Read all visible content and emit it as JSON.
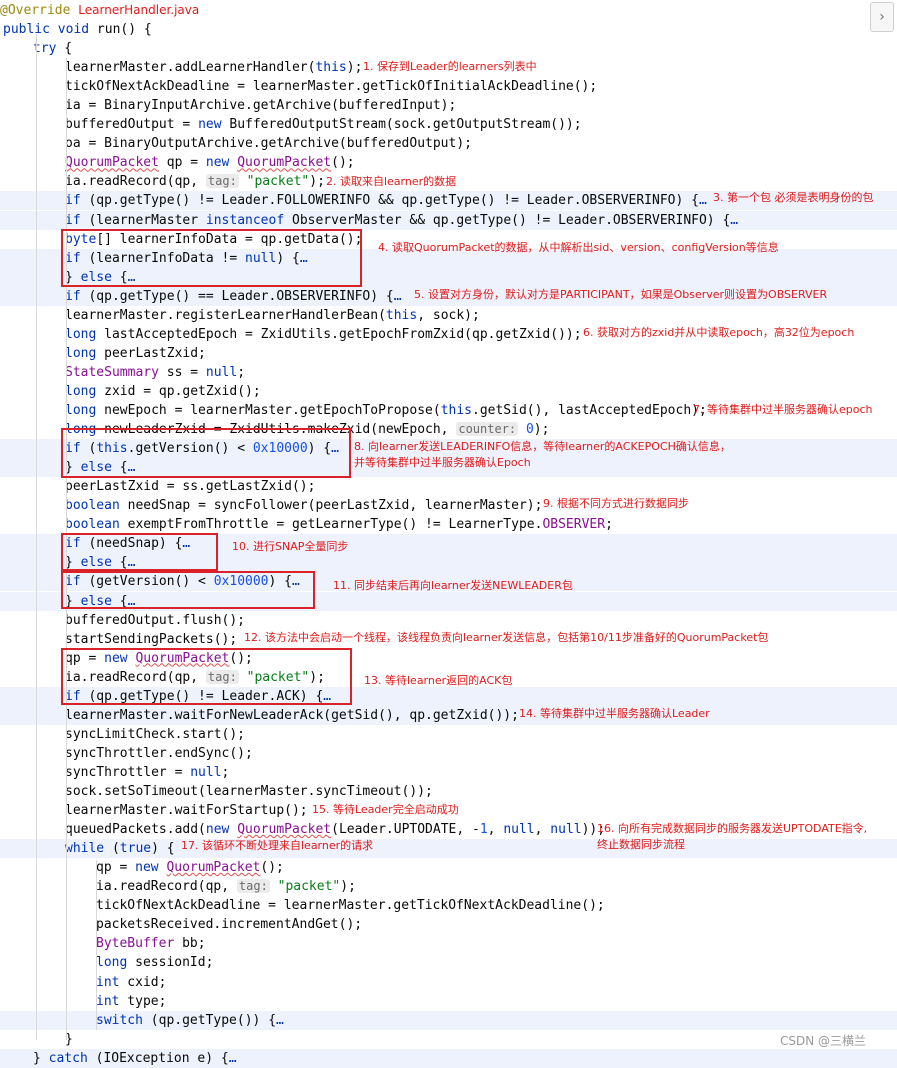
{
  "file_title": "LearnerHandler.java",
  "annotation": "@Override",
  "lines": [
    {
      "text": "public void run() {"
    },
    {
      "text": "try {"
    },
    {
      "text": "learnerMaster.addLearnerHandler(this);"
    },
    {
      "text": "tickOfNextAckDeadline = learnerMaster.getTickOfInitialAckDeadline();"
    },
    {
      "text": "ia = BinaryInputArchive.getArchive(bufferedInput);"
    },
    {
      "text": "bufferedOutput = new BufferedOutputStream(sock.getOutputStream());"
    },
    {
      "text": "oa = BinaryOutputArchive.getArchive(bufferedOutput);"
    },
    {
      "text": "QuorumPacket qp = new QuorumPacket();"
    },
    {
      "text": "ia.readRecord(qp, tag: \"packet\");"
    },
    {
      "text": "if (qp.getType() != Leader.FOLLOWERINFO && qp.getType() != Leader.OBSERVERINFO) {…"
    },
    {
      "text": "if (learnerMaster instanceof ObserverMaster && qp.getType() != Leader.OBSERVERINFO) {…"
    },
    {
      "text": "byte[] learnerInfoData = qp.getData();"
    },
    {
      "text": "if (learnerInfoData != null) {…"
    },
    {
      "text": "} else {…"
    },
    {
      "text": "if (qp.getType() == Leader.OBSERVERINFO) {…"
    },
    {
      "text": "learnerMaster.registerLearnerHandlerBean(this, sock);"
    },
    {
      "text": "long lastAcceptedEpoch = ZxidUtils.getEpochFromZxid(qp.getZxid());"
    },
    {
      "text": "long peerLastZxid;"
    },
    {
      "text": "StateSummary ss = null;"
    },
    {
      "text": "long zxid = qp.getZxid();"
    },
    {
      "text": "long newEpoch = learnerMaster.getEpochToPropose(this.getSid(), lastAcceptedEpoch);"
    },
    {
      "text": "long newLeaderZxid = ZxidUtils.makeZxid(newEpoch, counter: 0);"
    },
    {
      "text": "if (this.getVersion() < 0x10000) {…"
    },
    {
      "text": "} else {…"
    },
    {
      "text": "peerLastZxid = ss.getLastZxid();"
    },
    {
      "text": "boolean needSnap = syncFollower(peerLastZxid, learnerMaster);"
    },
    {
      "text": "boolean exemptFromThrottle = getLearnerType() != LearnerType.OBSERVER;"
    },
    {
      "text": "if (needSnap) {…"
    },
    {
      "text": "} else {…"
    },
    {
      "text": "if (getVersion() < 0x10000) {…"
    },
    {
      "text": "} else {…"
    },
    {
      "text": "bufferedOutput.flush();"
    },
    {
      "text": "startSendingPackets();"
    },
    {
      "text": "qp = new QuorumPacket();"
    },
    {
      "text": "ia.readRecord(qp, tag: \"packet\");"
    },
    {
      "text": "if (qp.getType() != Leader.ACK) {…"
    },
    {
      "text": "learnerMaster.waitForNewLeaderAck(getSid(), qp.getZxid());"
    },
    {
      "text": "syncLimitCheck.start();"
    },
    {
      "text": "syncThrottler.endSync();"
    },
    {
      "text": "syncThrottler = null;"
    },
    {
      "text": "sock.setSoTimeout(learnerMaster.syncTimeout());"
    },
    {
      "text": "learnerMaster.waitForStartup();"
    },
    {
      "text": "queuedPackets.add(new QuorumPacket(Leader.UPTODATE, -1, null, null));"
    },
    {
      "text": "while (true) {"
    },
    {
      "text": "qp = new QuorumPacket();"
    },
    {
      "text": "ia.readRecord(qp, tag: \"packet\");"
    },
    {
      "text": "tickOfNextAckDeadline = learnerMaster.getTickOfNextAckDeadline();"
    },
    {
      "text": "packetsReceived.incrementAndGet();"
    },
    {
      "text": "ByteBuffer bb;"
    },
    {
      "text": "long sessionId;"
    },
    {
      "text": "int cxid;"
    },
    {
      "text": "int type;"
    },
    {
      "text": "switch (qp.getType()) {…"
    },
    {
      "text": "}"
    },
    {
      "text": "} catch (IOException e) {…"
    }
  ],
  "notes": [
    "1. 保存到Leader的learners列表中",
    "2. 读取来自learner的数据",
    "3. 第一个包 必须是表明身份的包",
    "4. 读取QuorumPacket的数据，从中解析出sid、version、configVersion等信息",
    "5. 设置对方身份，默认对方是PARTICIPANT，如果是Observer则设置为OBSERVER",
    "6. 获取对方的zxid并从中读取epoch，高32位为epoch",
    "7. 等待集群中过半服务器确认epoch",
    "8. 向learner发送LEADERINFO信息，等待learner的ACKEPOCH确认信息，\n并等待集群中过半服务器确认Epoch",
    "9. 根据不同方式进行数据同步",
    "10. 进行SNAP全量同步",
    "11. 同步结束后再向learner发送NEWLEADER包",
    "12. 该方法中会启动一个线程，该线程负责向learner发送信息，包括第10/11步准备好的QuorumPacket包",
    "13. 等待learner返回的ACK包",
    "14. 等待集群中过半服务器确认Leader",
    "15. 等待Leader完全启动成功",
    "16. 向所有完成数据同步的服务器发送UPTODATE指令,\n终止数据同步流程",
    "17. 该循环不断处理来自learner的请求"
  ],
  "side_button": "›",
  "watermark": "CSDN @三横兰"
}
